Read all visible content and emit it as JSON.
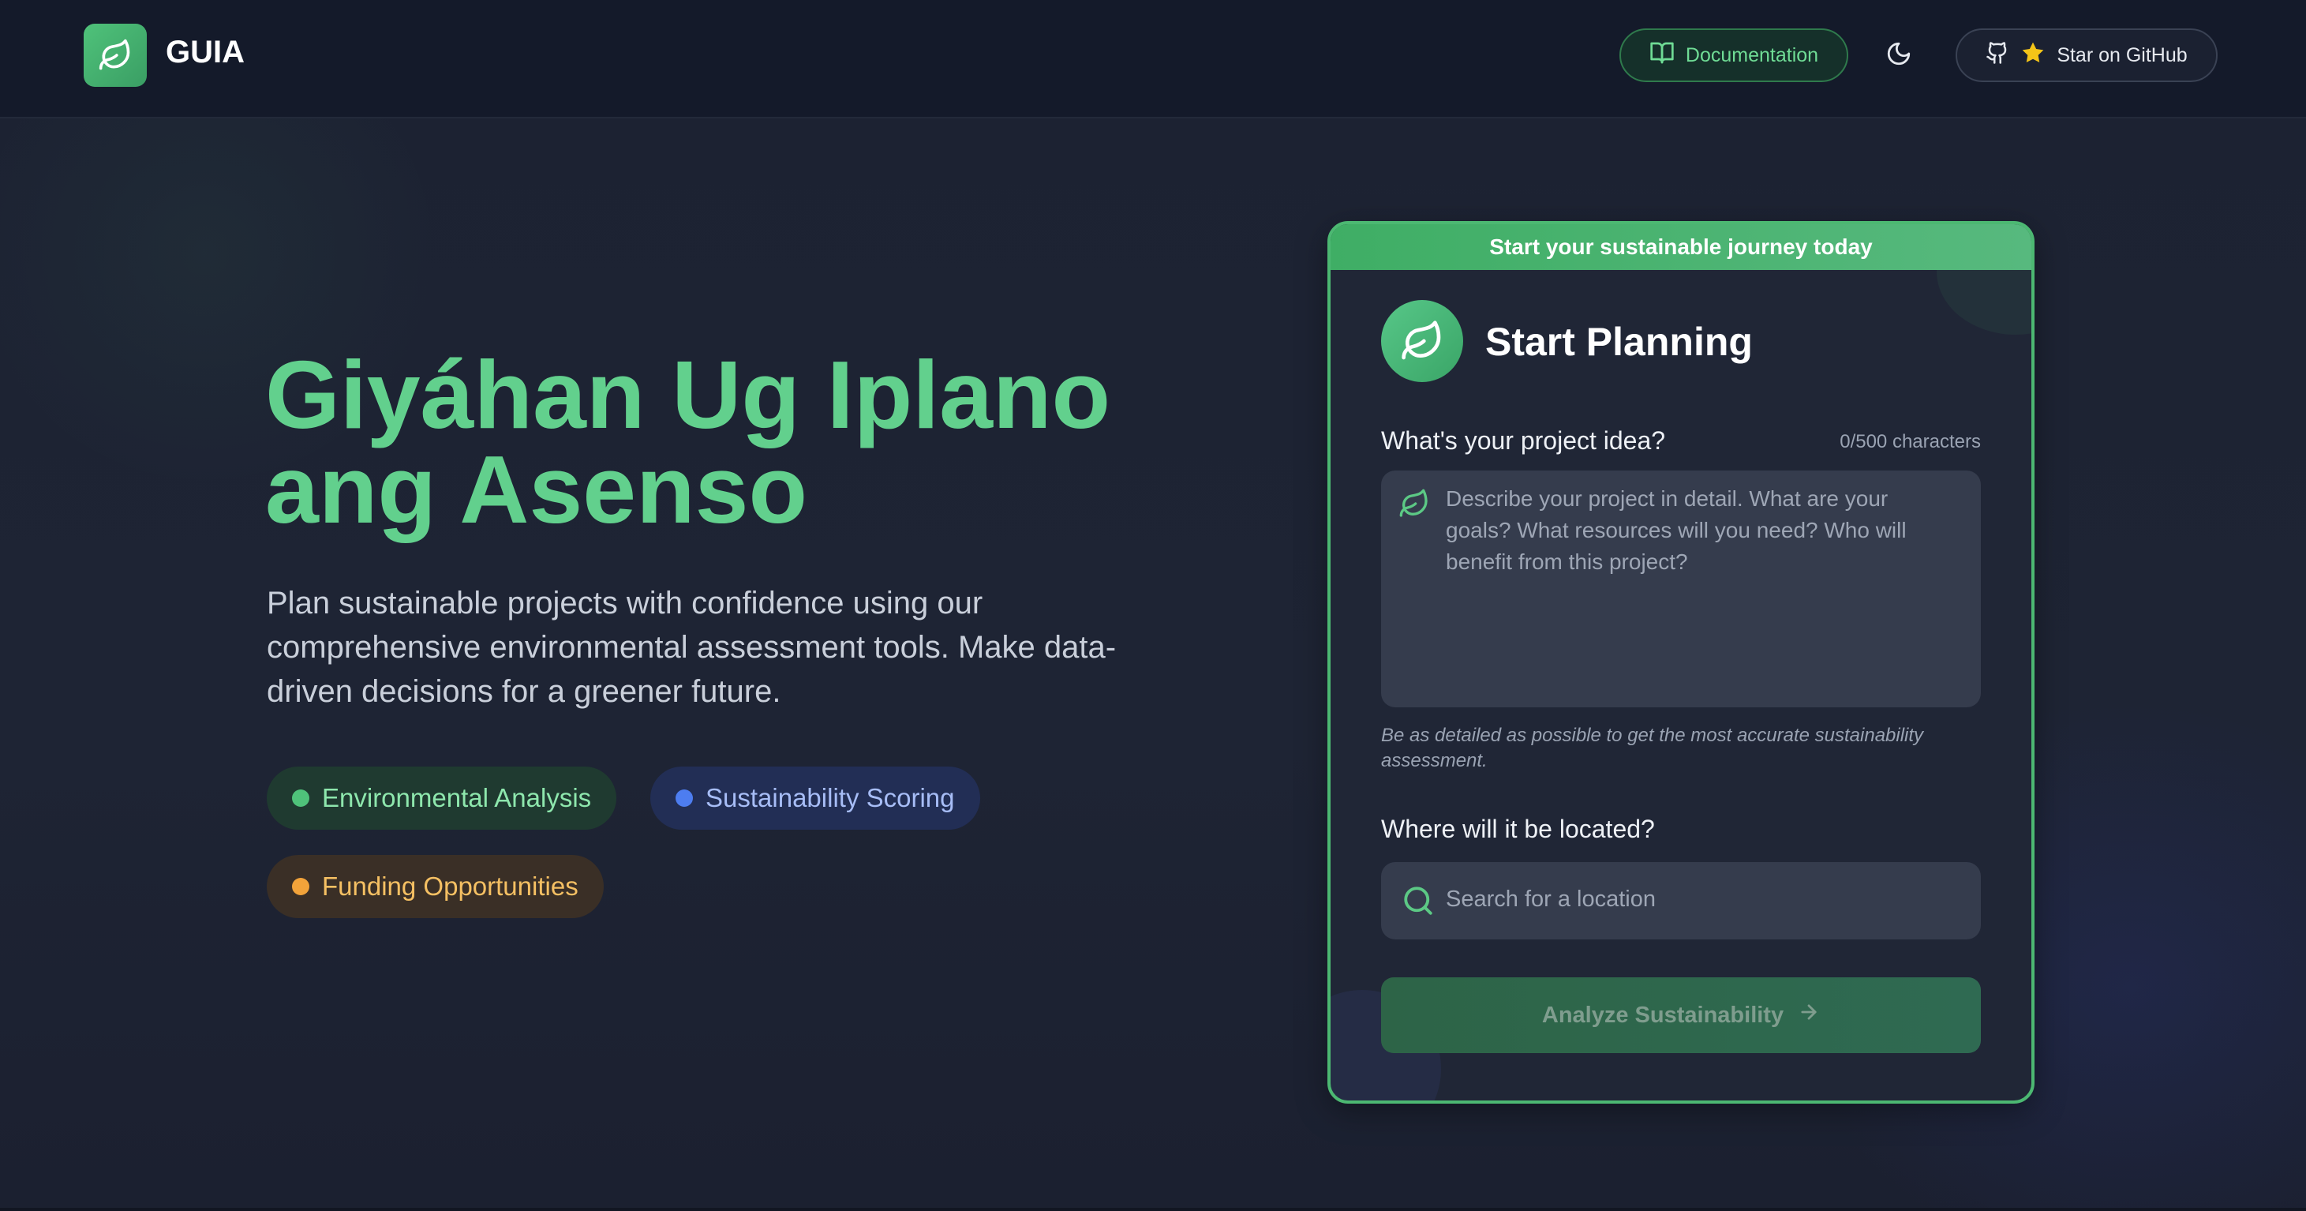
{
  "header": {
    "logo_text": "GUIA",
    "documentation_label": "Documentation",
    "github_label": "Star on GitHub"
  },
  "hero": {
    "title_line1": "Giyáhan Ug Iplano",
    "title_line2": "ang Asenso",
    "description": "Plan sustainable projects with confidence using our comprehensive environmental assessment tools. Make data-driven decisions for a greener future.",
    "chips": [
      {
        "label": "Environmental Analysis",
        "color": "#4fc27a"
      },
      {
        "label": "Sustainability Scoring",
        "color": "#4d7df0"
      },
      {
        "label": "Funding Opportunities",
        "color": "#f2a33a"
      }
    ]
  },
  "card": {
    "banner": "Start your sustainable journey today",
    "title": "Start Planning",
    "idea_label": "What's your project idea?",
    "char_count": "0/500 characters",
    "idea_placeholder": "Describe your project in detail. What are your goals? What resources will you need? Who will benefit from this project?",
    "hint": "Be as detailed as possible to get the most accurate sustainability assessment.",
    "location_label": "Where will it be located?",
    "location_placeholder": "Search for a location",
    "analyze_label": "Analyze Sustainability"
  },
  "colors": {
    "accent": "#62d08d",
    "card_border": "#4cb872",
    "background": "#1c2232"
  },
  "icons": {
    "logo": "leaf-icon",
    "documentation": "book-open-icon",
    "theme": "moon-icon",
    "github": "github-icon",
    "star": "star-icon",
    "search": "search-icon",
    "arrow": "arrow-right-icon"
  }
}
